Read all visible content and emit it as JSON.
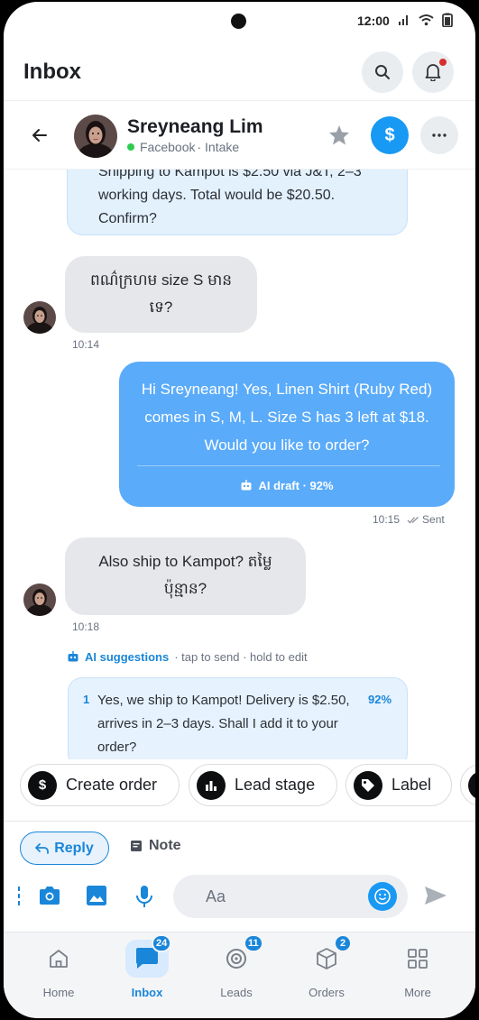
{
  "status_bar": {
    "time": "12:00"
  },
  "app_bar": {
    "title": "Inbox"
  },
  "contact": {
    "name": "Sreyneang Lim",
    "channel": "Facebook",
    "stage": "· Intake"
  },
  "messages": {
    "top_fragment": "Shipping to Kampot is $2.50 via J&T, 2–3 working days. Total would be $20.50. Confirm?",
    "in_1": {
      "text": "ពណ៌ក្រហម size S មាន ទេ?",
      "time": "10:14"
    },
    "out_1": {
      "text": "Hi Sreyneang! Yes, Linen Shirt (Ruby Red) comes in S, M, L. Size S has 3 left at $18. Would you like to order?",
      "ai_label": "AI draft · 92%",
      "time": "10:15",
      "status": "Sent"
    },
    "in_2": {
      "text": "Also ship to Kampot? តម្លៃ ប៉ុន្មាន?",
      "time": "10:18"
    }
  },
  "suggestions": {
    "title": "AI suggestions",
    "hint": "· tap to send · hold to edit",
    "items": [
      {
        "num": "1",
        "text": "Yes, we ship to Kampot! Delivery is $2.50, arrives in 2–3 days. Shall I add it to your order?",
        "confidence": "92%"
      }
    ]
  },
  "quick_actions": [
    {
      "label": "Create order",
      "icon": "dollar-icon"
    },
    {
      "label": "Lead stage",
      "icon": "bar-chart-icon"
    },
    {
      "label": "Label",
      "icon": "tag-icon"
    }
  ],
  "composer_tabs": {
    "reply": "Reply",
    "note": "Note"
  },
  "composer": {
    "placeholder": "Aa"
  },
  "nav": [
    {
      "label": "Home",
      "badge": ""
    },
    {
      "label": "Inbox",
      "badge": "24"
    },
    {
      "label": "Leads",
      "badge": "11"
    },
    {
      "label": "Orders",
      "badge": "2"
    },
    {
      "label": "More",
      "badge": ""
    }
  ],
  "colors": {
    "accent": "#1a86d9",
    "outgoing_bubble": "#5aabf9",
    "incoming_bubble": "#e6e7ea"
  }
}
